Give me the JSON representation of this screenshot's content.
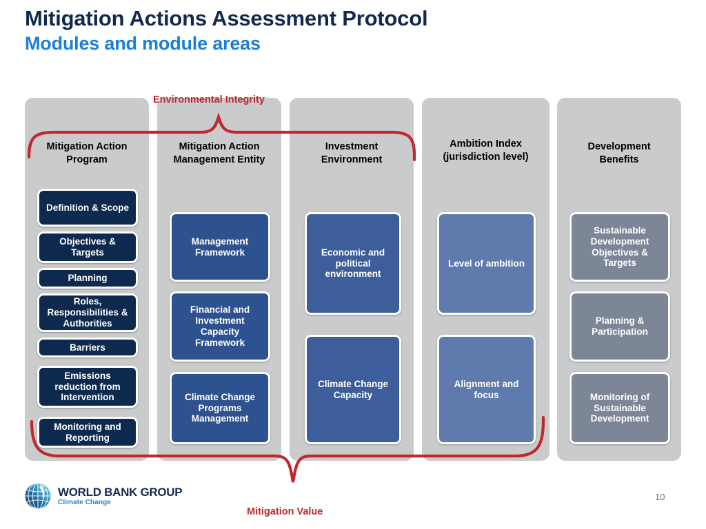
{
  "title": {
    "main": "Mitigation Actions Assessment Protocol",
    "sub": "Modules and module areas"
  },
  "brackets": {
    "top_label": "Environmental Integrity",
    "bottom_label": "Mitigation Value",
    "color": "#c1272d"
  },
  "columns": [
    {
      "id": "mitigation-action-program",
      "header": "Mitigation Action\nProgram",
      "header_line1": "Mitigation Action",
      "header_line2": "Program",
      "tone": "tone-navy",
      "color": "#0d2a4e",
      "items": [
        "Definition & Scope",
        "Objectives & Targets",
        "Planning",
        "Roles, Responsibilities & Authorities",
        "Barriers",
        "Emissions reduction from Intervention",
        "Monitoring and Reporting"
      ]
    },
    {
      "id": "mitigation-action-management-entity",
      "header_line1": "Mitigation Action",
      "header_line2": "Management Entity",
      "tone": "tone-blue",
      "color": "#2e5190",
      "items": [
        "Management Framework",
        "Financial and Investment Capacity Framework",
        "Climate Change Programs Management"
      ]
    },
    {
      "id": "investment-environment",
      "header_line1": "Investment",
      "header_line2": "Environment",
      "tone": "tone-blue2",
      "color": "#3d5d9b",
      "items": [
        "Economic and political environment",
        "Climate Change Capacity"
      ]
    },
    {
      "id": "ambition-index",
      "header_line1": "Ambition Index",
      "header_line2": "(jurisdiction level)",
      "tone": "tone-slate",
      "color": "#5f7aad",
      "items": [
        "Level of ambition",
        "Alignment and focus"
      ]
    },
    {
      "id": "development-benefits",
      "header_line1": "Development",
      "header_line2": "Benefits",
      "tone": "tone-gray",
      "color": "#7d8696",
      "items": [
        "Sustainable Development Objectives & Targets",
        "Planning & Participation",
        "Monitoring of Sustainable Development"
      ]
    }
  ],
  "footer": {
    "logo_wordmark": "WORLD BANK GROUP",
    "logo_tagline": "Climate Change",
    "page_number": "10"
  }
}
